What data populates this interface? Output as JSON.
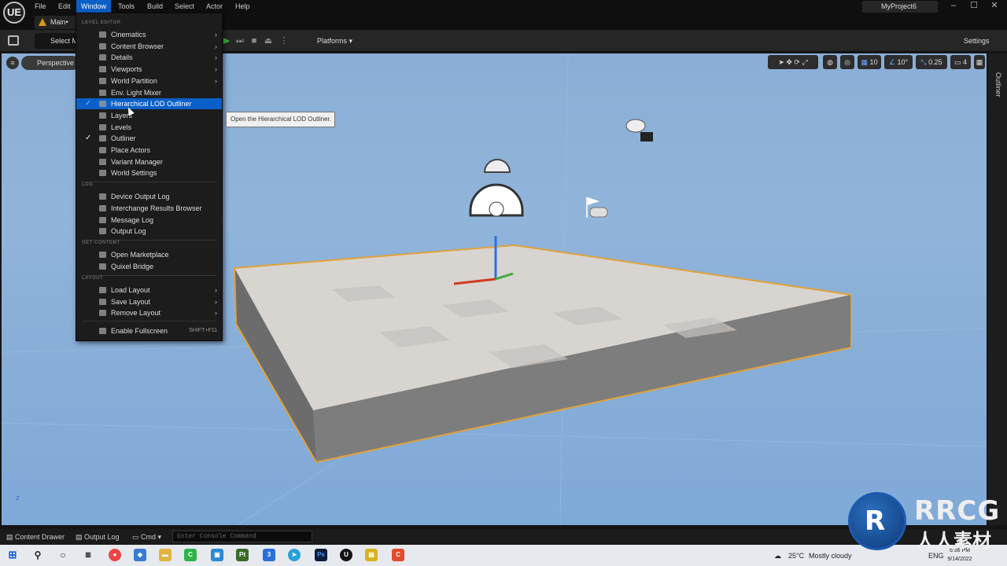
{
  "app": {
    "logo": "UE",
    "project": "MyProject6"
  },
  "menubar": [
    "File",
    "Edit",
    "Window",
    "Tools",
    "Build",
    "Select",
    "Actor",
    "Help"
  ],
  "window_controls": [
    "–",
    "☐",
    "✕"
  ],
  "tabs": {
    "main": "Main•"
  },
  "toolbar": {
    "select_mode": "Select M",
    "platforms": "Platforms",
    "settings": "Settings"
  },
  "viewport": {
    "view_mode": "Perspective",
    "grid_snap": "10",
    "rotation_snap": "10°",
    "scale_snap": "0.25",
    "camera_speed": "4",
    "axis_label": "z"
  },
  "window_menu": {
    "sections": {
      "level_editor": "LEVEL EDITOR",
      "log": "LOG",
      "get_content": "GET CONTENT",
      "layout": "LAYOUT"
    },
    "items": {
      "cinematics": "Cinematics",
      "content_browser": "Content Browser",
      "details": "Details",
      "viewports": "Viewports",
      "world_partition": "World Partition",
      "env_light_mixer": "Env. Light Mixer",
      "hlod_outliner": "Hierarchical LOD Outliner",
      "layers": "Layers",
      "levels": "Levels",
      "outliner": "Outliner",
      "place_actors": "Place Actors",
      "variant_manager": "Variant Manager",
      "world_settings": "World Settings",
      "device_output_log": "Device Output Log",
      "interchange_results": "Interchange Results Browser",
      "message_log": "Message Log",
      "output_log": "Output Log",
      "open_marketplace": "Open Marketplace",
      "quixel_bridge": "Quixel Bridge",
      "load_layout": "Load Layout",
      "save_layout": "Save Layout",
      "remove_layout": "Remove Layout",
      "enable_fullscreen": "Enable Fullscreen",
      "fullscreen_shortcut": "SHIFT+F11"
    },
    "tooltip": "Open the Hierarchical LOD Outliner."
  },
  "right_panel": {
    "outliner_tab": "Outliner"
  },
  "bottom_bar": {
    "content_drawer": "Content Drawer",
    "output_log": "Output Log",
    "cmd": "Cmd",
    "console_placeholder": "Enter Console Command"
  },
  "taskbar": {
    "weather_temp": "25°C",
    "weather_desc": "Mostly cloudy",
    "language": "ENG",
    "time": "6:36 PM",
    "date": "9/14/2022"
  },
  "watermark": {
    "brand": "RRCG",
    "sub": "人人素材"
  },
  "colors": {
    "accent": "#0a60c8",
    "sky": "#8ab0d8",
    "selection_outline": "#e0a23a"
  }
}
